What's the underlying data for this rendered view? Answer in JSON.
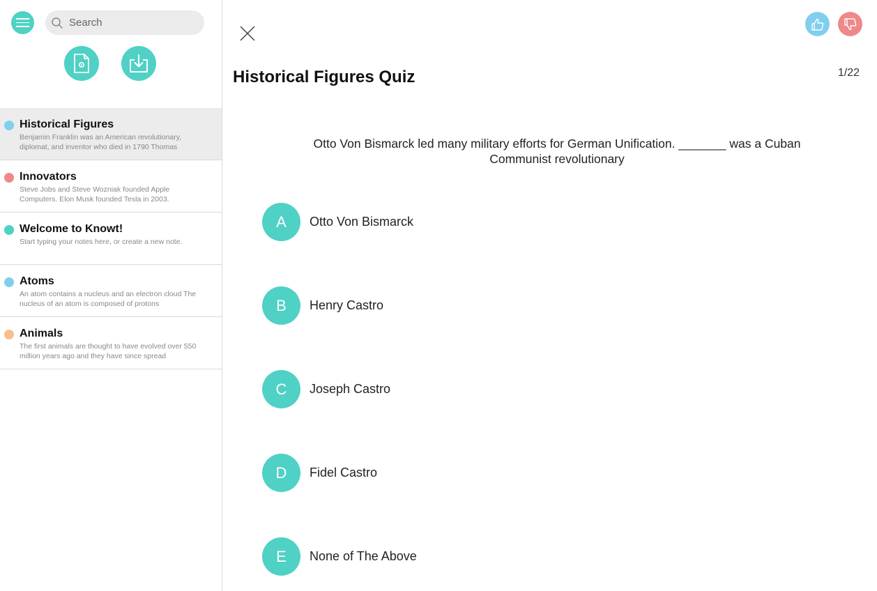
{
  "sidebar": {
    "search": {
      "placeholder": "Search"
    },
    "notes": [
      {
        "title": "Historical Figures",
        "snippet": "Benjamin Franklin was an American revolutionary, diplomat, and inventor who died in 1790 Thomas",
        "color": "#81cfee",
        "active": true
      },
      {
        "title": "Innovators",
        "snippet": "Steve Jobs and Steve Wozniak founded Apple Computers. Elon Musk founded Tesla in 2003.",
        "color": "#ef8888",
        "active": false
      },
      {
        "title": "Welcome to Knowt!",
        "snippet": "Start typing your notes here, or create a new note.",
        "color": "#4fd1c5",
        "active": false
      },
      {
        "title": "Atoms",
        "snippet": "An atom contains a nucleus and an electron cloud The nucleus of an atom is composed of protons",
        "color": "#81cfee",
        "active": false
      },
      {
        "title": "Animals",
        "snippet": "The first animals are thought to have evolved over 550 million years ago and they have since spread",
        "color": "#f7c08a",
        "active": false
      }
    ]
  },
  "quiz": {
    "title": "Historical Figures Quiz",
    "counter": "1/22",
    "question": "Otto Von Bismarck led many military efforts for German Unification. _______ was a Cuban Communist revolutionary",
    "options": [
      {
        "letter": "A",
        "text": "Otto Von Bismarck"
      },
      {
        "letter": "B",
        "text": "Henry Castro"
      },
      {
        "letter": "C",
        "text": "Joseph Castro"
      },
      {
        "letter": "D",
        "text": "Fidel Castro"
      },
      {
        "letter": "E",
        "text": "None of The Above"
      }
    ]
  },
  "colors": {
    "accent": "#4fd1c5",
    "like": "#81cfee",
    "dislike": "#ef8888"
  }
}
